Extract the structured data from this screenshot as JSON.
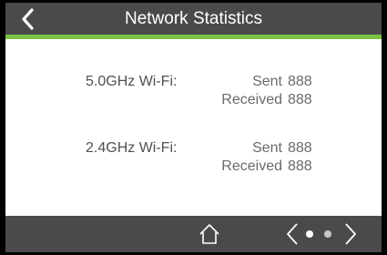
{
  "header": {
    "title": "Network Statistics"
  },
  "colors": {
    "accent": "#7bc143",
    "bar": "#4a4a4c"
  },
  "bands": [
    {
      "label": "5.0GHz Wi-Fi:",
      "sent_label": "Sent",
      "sent_value": "888",
      "received_label": "Received",
      "received_value": "888"
    },
    {
      "label": "2.4GHz Wi-Fi:",
      "sent_label": "Sent",
      "sent_value": "888",
      "received_label": "Received",
      "received_value": "888"
    }
  ],
  "footer": {
    "icons": [
      "home-icon",
      "chevron-left-icon",
      "page-dot-active",
      "page-dot-inactive",
      "chevron-right-icon"
    ]
  }
}
